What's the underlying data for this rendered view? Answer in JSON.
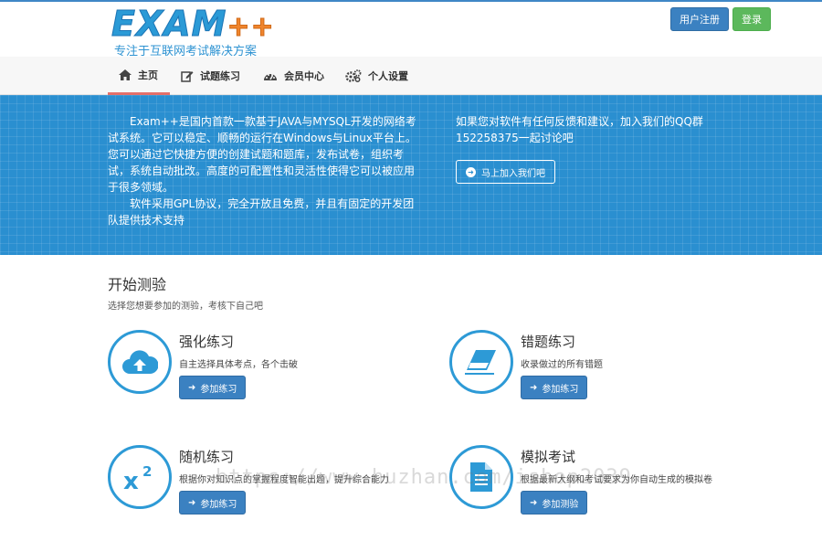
{
  "header": {
    "logo_word": "EXAM",
    "logo_plus": "++",
    "logo_tagline": "专注于互联网考试解决方案",
    "register_label": "用户注册",
    "login_label": "登录"
  },
  "nav": {
    "items": [
      {
        "label": "主页",
        "icon": "home-icon"
      },
      {
        "label": "试题练习",
        "icon": "edit-icon"
      },
      {
        "label": "会员中心",
        "icon": "dashboard-icon"
      },
      {
        "label": "个人设置",
        "icon": "gears-icon"
      }
    ]
  },
  "banner": {
    "para1": "Exam++是国内首款一款基于JAVA与MYSQL开发的网络考试系统。它可以稳定、顺畅的运行在Windows与Linux平台上。您可以通过它快捷方便的创建试题和题库，发布试卷，组织考试，系统自动批改。高度的可配置性和灵活性使得它可以被应用于很多领域。",
    "para2": "软件采用GPL协议，完全开放且免费，并且有固定的开发团队提供技术支持",
    "right_text": "如果您对软件有任何反馈和建议，加入我们的QQ群152258375一起讨论吧",
    "join_label": "马上加入我们吧"
  },
  "section": {
    "title": "开始测验",
    "subtitle": "选择您想要参加的测验，考核下自己吧"
  },
  "cards": [
    {
      "title": "强化练习",
      "desc": "自主选择具体考点，各个击破",
      "button": "参加练习",
      "icon": "cloud-upload-icon"
    },
    {
      "title": "错题练习",
      "desc": "收录做过的所有错题",
      "button": "参加练习",
      "icon": "eraser-icon"
    },
    {
      "title": "随机练习",
      "desc": "根据你对知识点的掌握程度智能出题，提升综合能力",
      "button": "参加练习",
      "icon": "superscript-icon"
    },
    {
      "title": "模拟考试",
      "desc": "根据最新大纲和考试要求为你自动生成的模拟卷",
      "button": "参加测验",
      "icon": "document-icon"
    }
  ],
  "watermark": "https://www.huzhan.com/ishop2039",
  "colors": {
    "accent": "#3b81c1",
    "banner": "#2a8fd0",
    "login": "#5cb85c",
    "nav_active": "#e4706a",
    "icon_ring": "#2d9ad6"
  }
}
